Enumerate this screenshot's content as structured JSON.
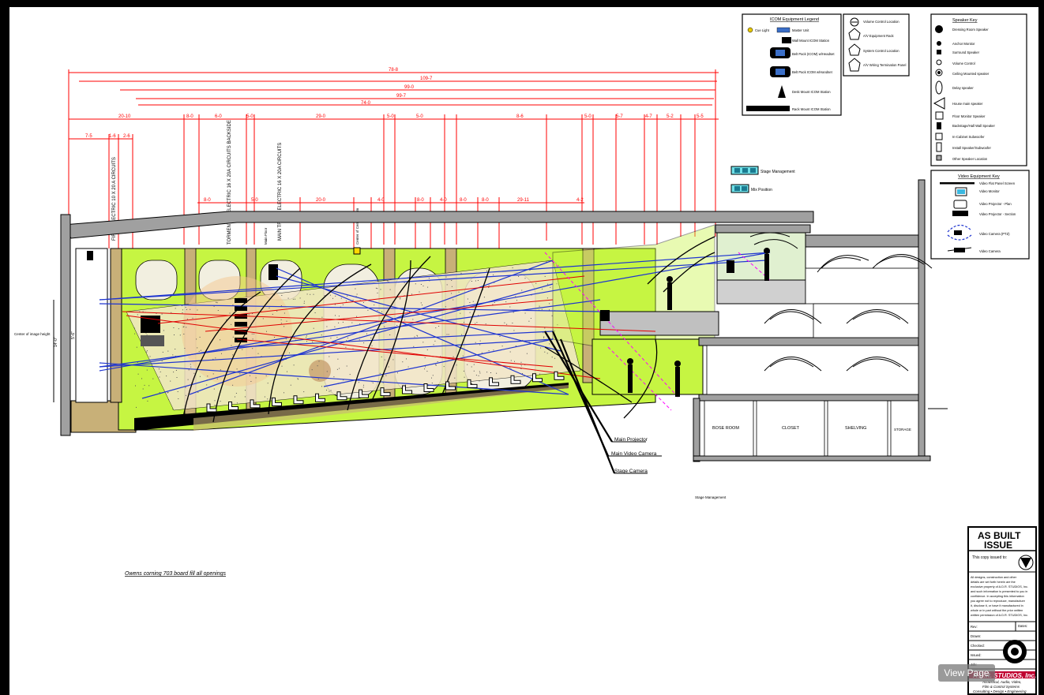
{
  "dims": {
    "top": [
      "78-8",
      "109-7",
      "99-0",
      "99-7",
      "74-0"
    ],
    "row1": [
      "20-10",
      "8-0",
      "6-0",
      "5-0",
      "29-0",
      "5-0",
      "5-0",
      "8-6",
      "5-0",
      "5-7",
      "4-7",
      "5-2",
      "5-5"
    ],
    "row2": [
      "7-5",
      "1-6",
      "2-6"
    ],
    "row3": [
      "8-0",
      "5-0",
      "20-0",
      "4-0",
      "8-0",
      "4-0",
      "8-0",
      "8-0",
      "29-11",
      "4-2"
    ]
  },
  "vertical_labels": [
    "FIRST ELECTRIC 10 X 20 A CIRCUITS",
    "TORMENTOR ELECTRIC 16 X 20A CIRCUITS BACKSIDE",
    "MAIN TRUSS ELECTRIC 16 X 20A CIRCUITS"
  ],
  "small_labels": {
    "center_of_image": "Center of image height",
    "center_beam": "Center of Center Beam",
    "main_floor": "Main Floor",
    "dim_left": "14'-0\"",
    "dim_left2": "5'-6\""
  },
  "rooms": [
    "BOSE ROOM",
    "CLOSET",
    "SHELVING",
    "STORAGE"
  ],
  "callouts": [
    "Main Projector",
    "Main Video Camera",
    "Stage Camera"
  ],
  "stage_mgmt_center": "Stage Management",
  "note": "Owens corning 703 board fill all openings",
  "legend_icom": {
    "title": "ICOM Equipment Legend",
    "items": [
      "Cue Light",
      "Master Unit",
      "Wall Mount ICOM Station",
      "Belt Pack (ICOM) w/Headset",
      "Belt Pack ICOM w/Handset",
      "Desk Mount ICOM Station",
      "Rack Mount ICOM Station"
    ]
  },
  "legend_control": {
    "items": [
      "Volume Control Location",
      "A/V Equipment Rack",
      "System Control Location",
      "A/V Wiring Termination Panel"
    ]
  },
  "legend_speaker": {
    "title": "Speaker Key",
    "items": [
      "Dressing Room Speaker",
      "Anchor Monitor",
      "Surround Speaker",
      "Volume Control",
      "Ceiling Mounted speaker",
      "Delay speaker",
      "House main speaker",
      "Floor Monitor Speaker",
      "Backstage/Hall Wall Speaker",
      "In-Cabinet Subwoofer",
      "Install Speaker/Subwoofer",
      "Other Speaker Location"
    ]
  },
  "legend_video": {
    "title": "Video Equipment Key",
    "items": [
      "Video Flat Panel Screen",
      "Video Monitor",
      "Video Projector - Plan",
      "Video Projector - Section",
      "Video Camera (PTZ)",
      "Video Camera"
    ]
  },
  "stage_keys": [
    "Stage Management",
    "Mix Position"
  ],
  "title_block": {
    "heading1": "AS BUILT",
    "heading2": "ISSUE",
    "issued_to": "This copy issued to:",
    "legal": [
      "All designs, construction and other",
      "details are set forth herein are the",
      "exclusive property of A.D.R. STUDIOS, Inc.",
      "and such information is presented to you in",
      "confidence. In accepting this information",
      "you agree not to reproduce, manufacture",
      "it, disclose it, or have it manufactured in",
      "whole or in part without the prior written",
      "written permission of A.D.R. STUDIOS, Inc."
    ],
    "fields": [
      "Rev:",
      "Drawn:",
      "Checked:",
      "Issued:",
      "Job:"
    ],
    "date_field": "Dates:",
    "company": "A.D.R. STUDIOS, Inc.",
    "tagline1": "Acoustical, Audio, Video,",
    "tagline2": "Film & Control Systems",
    "tagline3": "Consulting • Design • Engineering"
  },
  "view_button": "View Page",
  "colors": {
    "wall": "#a0a0a0",
    "panel_green": "#c6f542",
    "sky_beige": "#f2e6c8",
    "ray_blue": "#1e34d0",
    "ray_red": "#e00000",
    "dim_red": "#ff0000",
    "accent_magenta": "#ff00ff"
  }
}
